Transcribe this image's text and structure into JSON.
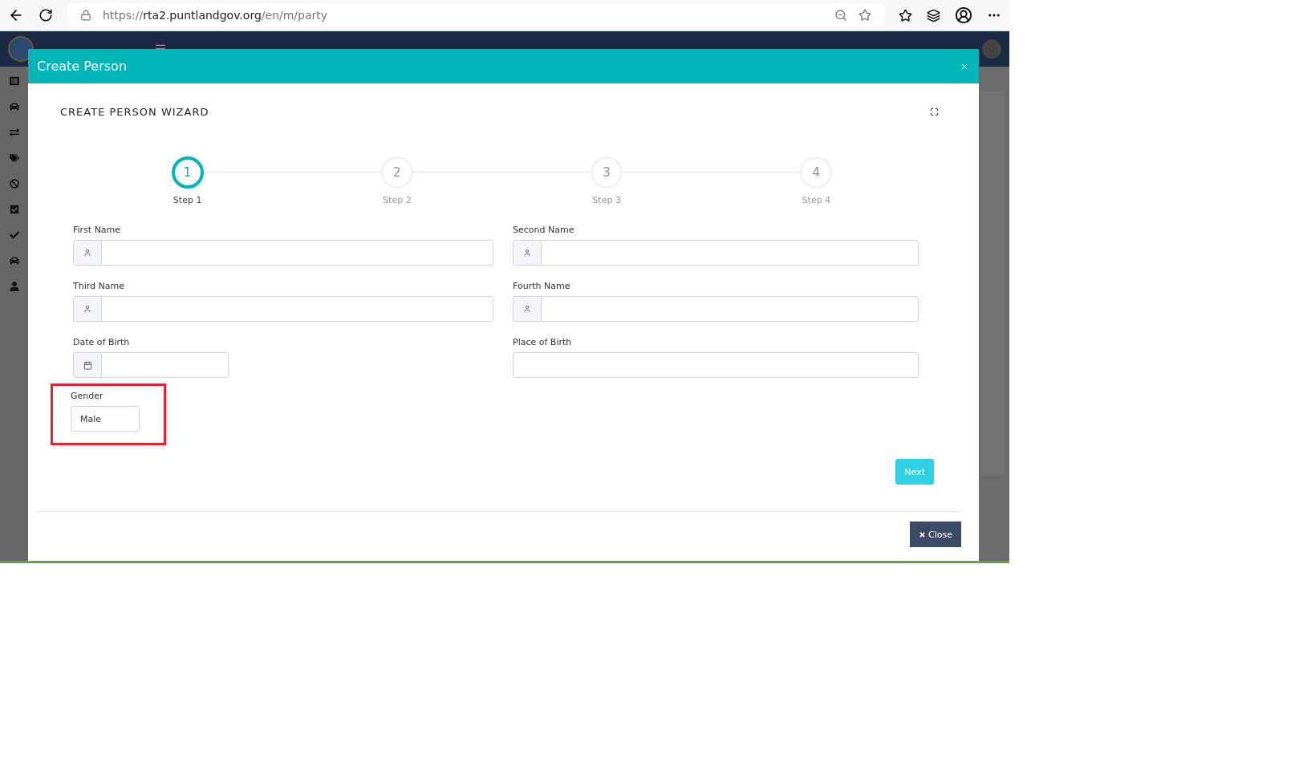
{
  "browser": {
    "url": {
      "scheme": "https://",
      "host": "rta2.puntlandgov.org",
      "path": "/en/m/party"
    }
  },
  "modal": {
    "title": "Create Person",
    "wizard_title": "CREATE PERSON WIZARD",
    "steps": [
      {
        "number": "1",
        "label": "Step 1",
        "selected": true
      },
      {
        "number": "2",
        "label": "Step 2",
        "selected": false
      },
      {
        "number": "3",
        "label": "Step 3",
        "selected": false
      },
      {
        "number": "4",
        "label": "Step 4",
        "selected": false
      }
    ],
    "fields": [
      {
        "label": "First Name",
        "kind": "person",
        "highlighted": false
      },
      {
        "label": "Second Name",
        "kind": "person",
        "highlighted": false
      },
      {
        "label": "Third Name",
        "kind": "person",
        "highlighted": false
      },
      {
        "label": "Fourth Name",
        "kind": "person",
        "highlighted": false
      },
      {
        "label": "Date of Birth",
        "kind": "date",
        "highlighted": false
      },
      {
        "label": "Place of Birth",
        "kind": "plain",
        "highlighted": false
      },
      {
        "label": "Gender",
        "kind": "select",
        "value": "Male",
        "highlighted": true
      }
    ],
    "next_button": "Next",
    "close_button": "Close"
  }
}
